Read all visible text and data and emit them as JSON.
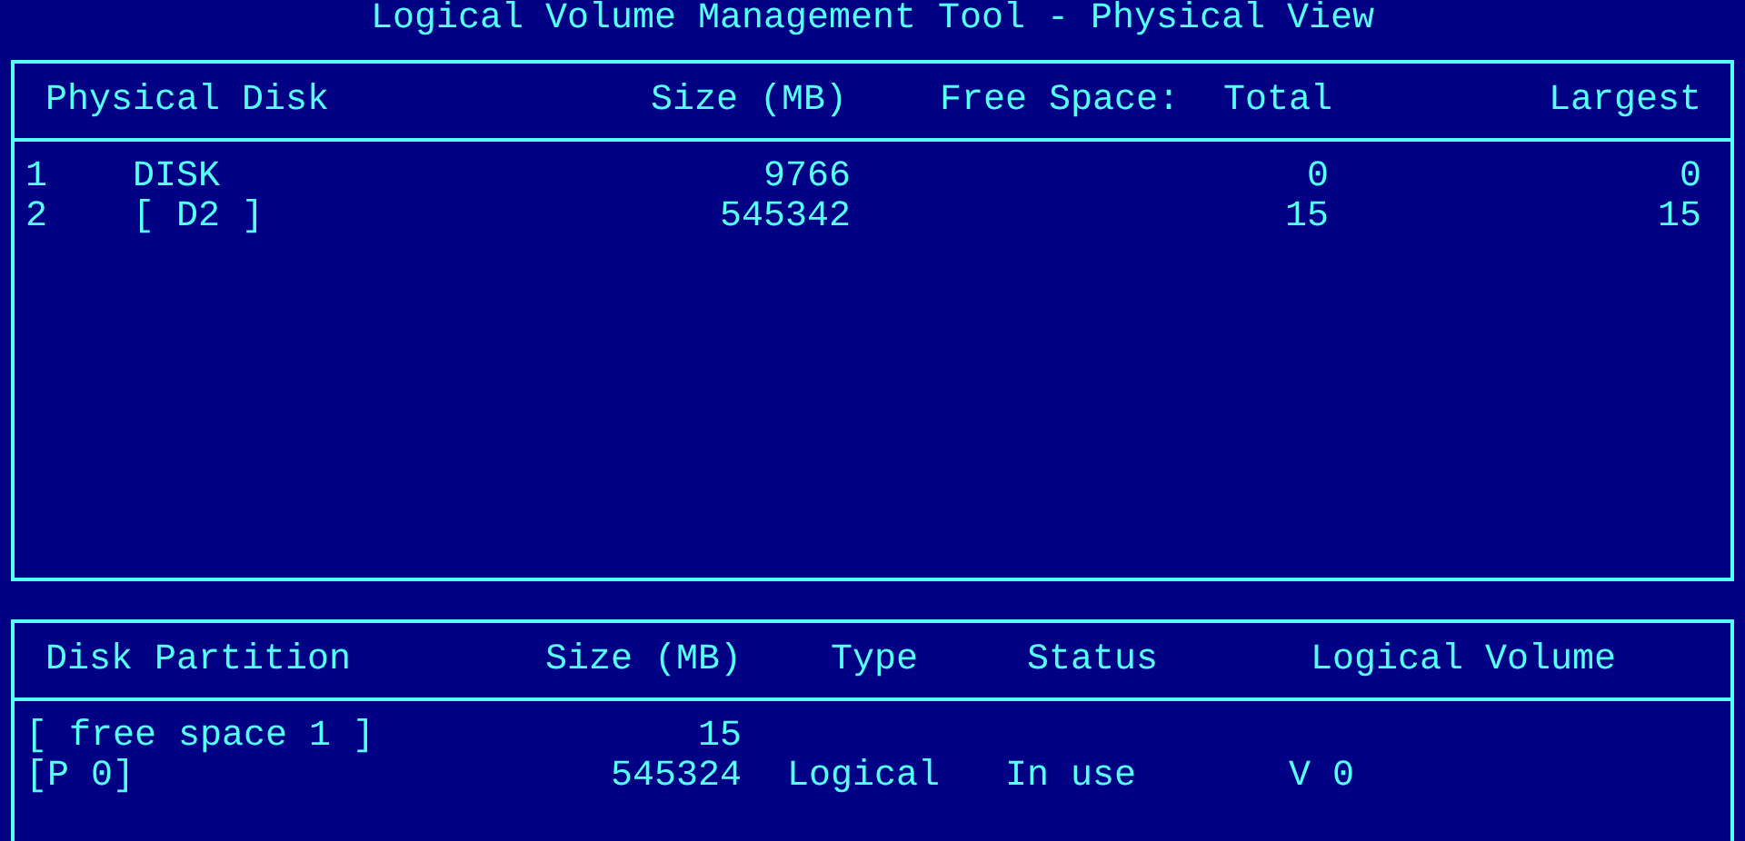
{
  "window": {
    "title": "Logical Volume Management Tool - Physical View"
  },
  "disks": {
    "columns": [
      "Physical Disk",
      "Size (MB)",
      "Free Space:",
      "Total",
      "Largest"
    ],
    "rows": [
      {
        "number": "1",
        "name": "DISK",
        "size": "9766",
        "total": "0",
        "largest": "0"
      },
      {
        "number": "2",
        "name": "[ D2 ]",
        "size": "545342",
        "total": "15",
        "largest": "15"
      }
    ]
  },
  "partitions": {
    "columns": [
      "Disk Partition",
      "Size (MB)",
      "Type",
      "Status",
      "Logical Volume"
    ],
    "rows": [
      {
        "name": "[ free space 1 ]",
        "size": "15"
      },
      {
        "name": "[P 0]",
        "size": "545324",
        "type": "Logical",
        "status": "In use",
        "volume": "V 0"
      }
    ]
  }
}
